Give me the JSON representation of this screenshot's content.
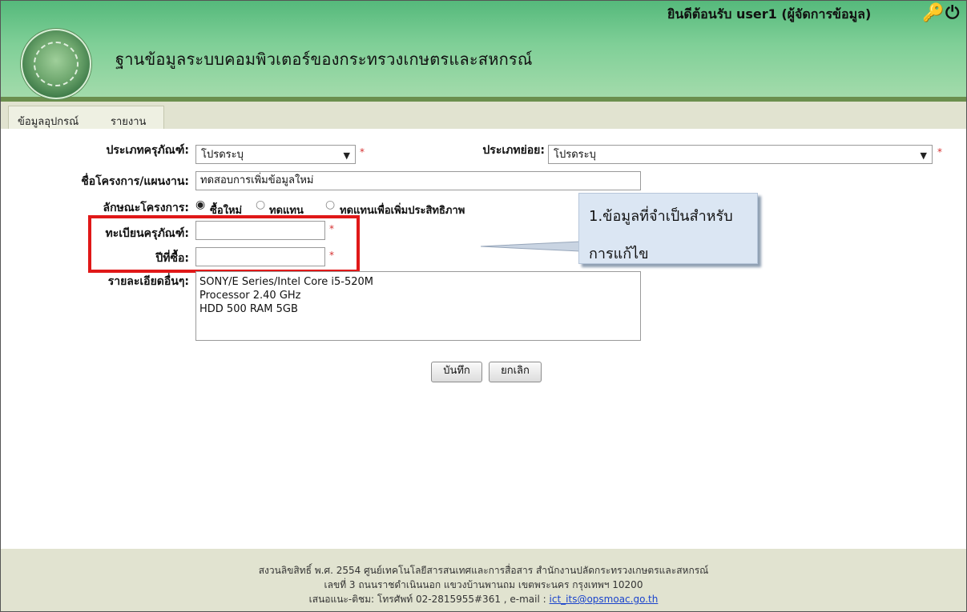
{
  "header": {
    "title": "ฐานข้อมูลระบบคอมพิวเตอร์ของกระทรวงเกษตรและสหกรณ์",
    "welcome": "ยินดีต้อนรับ user1 (ผู้จัดการข้อมูล)",
    "key_icon": "key-icon",
    "power_icon": "power-icon"
  },
  "menu": {
    "items": [
      {
        "label": "ข้อมูลอุปกรณ์"
      },
      {
        "label": "รายงาน"
      }
    ]
  },
  "form": {
    "equipment_type_label": "ประเภทครุภัณฑ์:",
    "equipment_type_value": "โปรดระบุ",
    "subtype_label": "ประเภทย่อย:",
    "subtype_value": "โปรดระบุ",
    "project_label": "ชื่อโครงการ/แผนงาน:",
    "project_value": "ทดสอบการเพิ่มข้อมูลใหม่",
    "nature_label": "ลักษณะโครงการ:",
    "nature_options": [
      {
        "label": "ซื้อใหม่",
        "selected": true
      },
      {
        "label": "ทดแทน",
        "selected": false
      },
      {
        "label": "ทดแทนเพื่อเพิ่มประสิทธิภาพ",
        "selected": false
      }
    ],
    "registration_label": "ทะเบียนครุภัณฑ์:",
    "registration_value": "",
    "year_label": "ปีที่ซื้อ:",
    "year_value": "",
    "details_label": "รายละเอียดอื่นๆ:",
    "details_lines": [
      "SONY/E Series/Intel Core i5-520M",
      "Processor 2.40 GHz",
      "HDD 500 RAM 5GB"
    ],
    "required_mark": "*"
  },
  "callout": {
    "line1": "1.ข้อมูลที่จำเป็นสำหรับ",
    "line2": "การแก้ไข"
  },
  "buttons": {
    "save": "บันทึก",
    "cancel": "ยกเลิก"
  },
  "footer": {
    "line1": "สงวนลิขสิทธิ์ พ.ศ. 2554 ศูนย์เทคโนโลยีสารสนเทศและการสื่อสาร สำนักงานปลัดกระทรวงเกษตรและสหกรณ์",
    "line2": "เลขที่ 3 ถนนราชดำเนินนอก แขวงบ้านพานถม เขตพระนคร กรุงเทพฯ 10200",
    "line3_prefix": "เสนอแนะ-ติชม: โทรศัพท์ 02-2815955#361 , e-mail :",
    "email": "ict_its@opsmoac.go.th"
  },
  "colors": {
    "header_green": "#7fcf97",
    "menubar": "#e1e3d0",
    "required_red": "#d63030",
    "highlight_red": "#e01818",
    "callout_blue": "#dbe6f3",
    "link_blue": "#1a44cc"
  }
}
